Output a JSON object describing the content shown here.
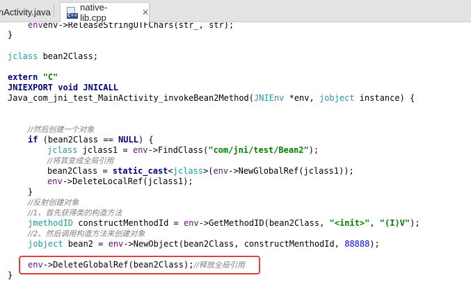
{
  "tabs": [
    {
      "label": "nActivity.java",
      "active": false
    },
    {
      "label": "native-lib.cpp",
      "active": true,
      "icon": "cpp-file-icon",
      "icon_text": "C++",
      "close": "✕"
    }
  ],
  "code": {
    "l0": "env->ReleaseStringUTFChars(str_, str);",
    "l1": "}",
    "l3_kw": "jclass",
    "l3_rest": " bean2Class;",
    "l5_kw": "extern",
    "l5_str": "\"C\"",
    "l6": "JNIEXPORT void JNICALL",
    "l7_a": "Java_com_jni_test_MainActivity_invokeBean2Method(",
    "l7_b": "JNIEnv",
    "l7_c": " *env, ",
    "l7_d": "jobject",
    "l7_e": " instance) {",
    "l10": "//然后创建一个对象",
    "l11_kw": "if",
    "l11_a": " (bean2Class == ",
    "l11_null": "NULL",
    "l11_b": ") {",
    "l12_ty": "jclass",
    "l12_a": " jclass1 = ",
    "l12_env": "env",
    "l12_b": "->FindClass(",
    "l12_str": "\"com/jni/test/Bean2\"",
    "l12_c": ");",
    "l13": "//将其变成全局引用",
    "l14_a": "bean2Class = ",
    "l14_kw": "static_cast",
    "l14_b": "<",
    "l14_ty": "jclass",
    "l14_c": ">(",
    "l14_env": "env",
    "l14_d": "->NewGlobalRef(jclass1));",
    "l15_env": "env",
    "l15_a": "->DeleteLocalRef(jclass1);",
    "l16": "}",
    "l17": "//反射创建对象",
    "l18": "//1、首先获得类的构造方法",
    "l19_ty": "jmethodID",
    "l19_a": " constructMenthodId = ",
    "l19_env": "env",
    "l19_b": "->GetMethodID(bean2Class, ",
    "l19_s1": "\"<init>\"",
    "l19_c": ", ",
    "l19_s2": "\"(I)V\"",
    "l19_d": ");",
    "l20": "//2、然后调用构造方法来创建对象",
    "l21_ty": "jobject",
    "l21_a": " bean2 = ",
    "l21_env": "env",
    "l21_b": "->NewObject(bean2Class, constructMenthodId, ",
    "l21_num": "88888",
    "l21_c": ");",
    "l23_env": "env",
    "l23_a": "->DeleteGlobalRef(bean2Class);",
    "l23_cm": "//释放全局引用",
    "l24": "}"
  }
}
